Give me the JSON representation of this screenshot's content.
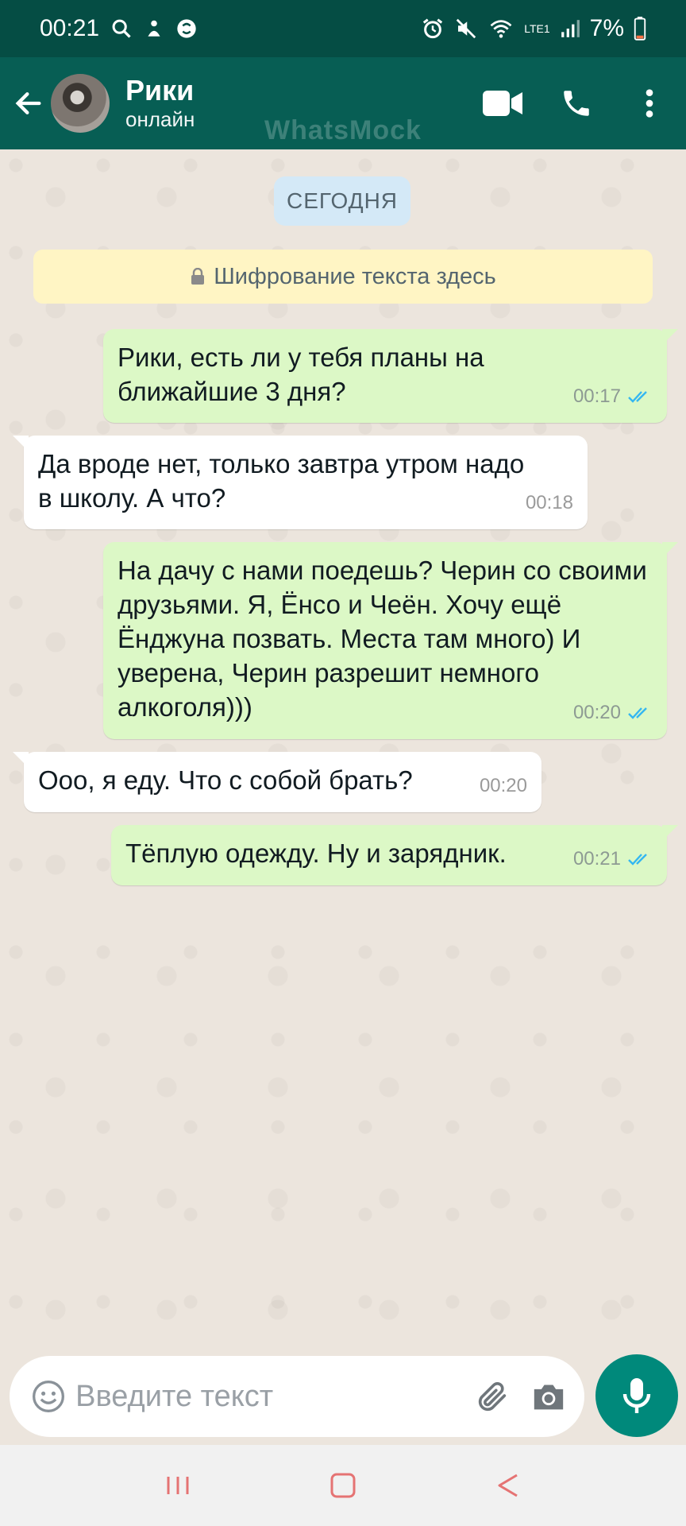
{
  "status_bar": {
    "time": "00:21",
    "battery": "7%",
    "network": "LTE1"
  },
  "header": {
    "contact_name": "Рики",
    "contact_status": "онлайн",
    "watermark": "WhatsMock"
  },
  "chat": {
    "date_label": "СЕГОДНЯ",
    "encryption_notice": "Шифрование текста здесь",
    "messages": [
      {
        "direction": "out",
        "text": "Рики, есть ли у тебя планы на ближайшие 3 дня?",
        "time": "00:17",
        "read": true
      },
      {
        "direction": "in",
        "text": "Да вроде нет, только завтра утром надо в школу. А что?",
        "time": "00:18"
      },
      {
        "direction": "out",
        "text": "На дачу с нами поедешь? Черин со своими друзьями. Я, Ёнсо и Чеён. Хочу ещё Ёнджуна позвать. Места там много) И уверена, Черин разрешит немного алкоголя)))",
        "time": "00:20",
        "read": true
      },
      {
        "direction": "in",
        "text": "Ооо, я еду. Что с собой брать?",
        "time": "00:20"
      },
      {
        "direction": "out",
        "text": "Тёплую одежду. Ну и зарядник.",
        "time": "00:21",
        "read": true
      }
    ]
  },
  "composer": {
    "placeholder": "Введите текст"
  },
  "colors": {
    "status_bar": "#054d44",
    "header": "#075e54",
    "outgoing_bubble": "#dcf8c6",
    "incoming_bubble": "#ffffff",
    "mic_button": "#00897b",
    "read_tick": "#34b7f1"
  },
  "icons": {
    "back": "arrow-left-icon",
    "video": "video-camera-icon",
    "call": "phone-icon",
    "menu": "more-vert-icon",
    "emoji": "emoji-icon",
    "attach": "paperclip-icon",
    "camera": "camera-icon",
    "mic": "microphone-icon"
  }
}
